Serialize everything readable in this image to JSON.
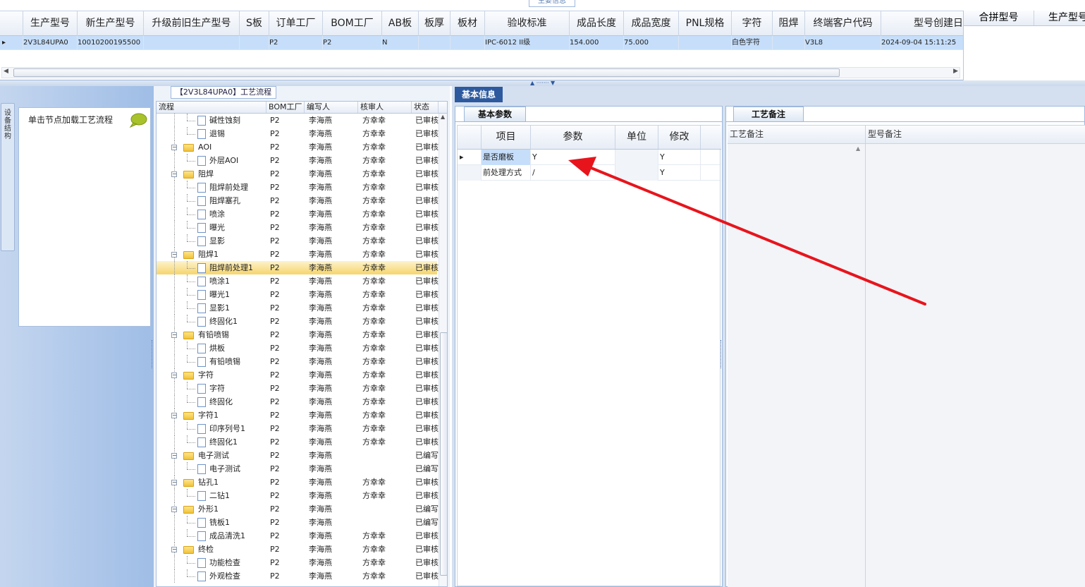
{
  "top_grid": {
    "caption": "主要信息",
    "columns": [
      "生产型号",
      "新生产型号",
      "升级前旧生产型号",
      "S板",
      "订单工厂",
      "BOM工厂",
      "AB板",
      "板厚",
      "板材",
      "验收标准",
      "成品长度",
      "成品宽度",
      "PNL规格",
      "字符",
      "阻焊",
      "终端客户代码",
      "型号创建日"
    ],
    "row": {
      "生产型号": "2V3L84UPA0",
      "新生产型号": "10010200195500",
      "升级前旧生产型号": "",
      "S板": "",
      "订单工厂": "P2",
      "BOM工厂": "P2",
      "AB板": "N",
      "板厚": "",
      "板材": "",
      "验收标准": "IPC-6012 II级",
      "成品长度": "154.000",
      "成品宽度": "75.000",
      "PNL规格": "",
      "字符": "白色字符",
      "阻焊": "",
      "终端客户代码": "V3L8",
      "型号创建日": "2024-09-04 15:11:25"
    }
  },
  "merge_panel": {
    "columns": [
      "合拼型号",
      "生产型号"
    ]
  },
  "left_sidebar": {
    "vertical_tab": "设备结构",
    "node_hint": "单击节点加载工艺流程"
  },
  "process_tree": {
    "caption": "【2V3L84UPA0】工艺流程",
    "columns": [
      "流程",
      "BOM工厂",
      "编写人",
      "核审人",
      "状态"
    ],
    "rows": [
      {
        "level": 2,
        "name": "碱性蚀刻",
        "bom": "P2",
        "writer": "李海燕",
        "reviewer": "方幸幸",
        "status": "已审核"
      },
      {
        "level": 2,
        "name": "退锡",
        "bom": "P2",
        "writer": "李海燕",
        "reviewer": "方幸幸",
        "status": "已审核"
      },
      {
        "level": 1,
        "name": "AOI",
        "bom": "P2",
        "writer": "李海燕",
        "reviewer": "方幸幸",
        "status": "已审核"
      },
      {
        "level": 2,
        "name": "外层AOI",
        "bom": "P2",
        "writer": "李海燕",
        "reviewer": "方幸幸",
        "status": "已审核"
      },
      {
        "level": 1,
        "name": "阻焊",
        "bom": "P2",
        "writer": "李海燕",
        "reviewer": "方幸幸",
        "status": "已审核"
      },
      {
        "level": 2,
        "name": "阻焊前处理",
        "bom": "P2",
        "writer": "李海燕",
        "reviewer": "方幸幸",
        "status": "已审核"
      },
      {
        "level": 2,
        "name": "阻焊塞孔",
        "bom": "P2",
        "writer": "李海燕",
        "reviewer": "方幸幸",
        "status": "已审核"
      },
      {
        "level": 2,
        "name": "喷涂",
        "bom": "P2",
        "writer": "李海燕",
        "reviewer": "方幸幸",
        "status": "已审核"
      },
      {
        "level": 2,
        "name": "曝光",
        "bom": "P2",
        "writer": "李海燕",
        "reviewer": "方幸幸",
        "status": "已审核"
      },
      {
        "level": 2,
        "name": "显影",
        "bom": "P2",
        "writer": "李海燕",
        "reviewer": "方幸幸",
        "status": "已审核"
      },
      {
        "level": 1,
        "name": "阻焊1",
        "bom": "P2",
        "writer": "李海燕",
        "reviewer": "方幸幸",
        "status": "已审核"
      },
      {
        "level": 2,
        "name": "阻焊前处理1",
        "bom": "P2",
        "writer": "李海燕",
        "reviewer": "方幸幸",
        "status": "已审核",
        "selected": true
      },
      {
        "level": 2,
        "name": "喷涂1",
        "bom": "P2",
        "writer": "李海燕",
        "reviewer": "方幸幸",
        "status": "已审核"
      },
      {
        "level": 2,
        "name": "曝光1",
        "bom": "P2",
        "writer": "李海燕",
        "reviewer": "方幸幸",
        "status": "已审核"
      },
      {
        "level": 2,
        "name": "显影1",
        "bom": "P2",
        "writer": "李海燕",
        "reviewer": "方幸幸",
        "status": "已审核"
      },
      {
        "level": 2,
        "name": "终固化1",
        "bom": "P2",
        "writer": "李海燕",
        "reviewer": "方幸幸",
        "status": "已审核"
      },
      {
        "level": 1,
        "name": "有铅喷锡",
        "bom": "P2",
        "writer": "李海燕",
        "reviewer": "方幸幸",
        "status": "已审核"
      },
      {
        "level": 2,
        "name": "烘板",
        "bom": "P2",
        "writer": "李海燕",
        "reviewer": "方幸幸",
        "status": "已审核"
      },
      {
        "level": 2,
        "name": "有铅喷锡",
        "bom": "P2",
        "writer": "李海燕",
        "reviewer": "方幸幸",
        "status": "已审核"
      },
      {
        "level": 1,
        "name": "字符",
        "bom": "P2",
        "writer": "李海燕",
        "reviewer": "方幸幸",
        "status": "已审核"
      },
      {
        "level": 2,
        "name": "字符",
        "bom": "P2",
        "writer": "李海燕",
        "reviewer": "方幸幸",
        "status": "已审核"
      },
      {
        "level": 2,
        "name": "终固化",
        "bom": "P2",
        "writer": "李海燕",
        "reviewer": "方幸幸",
        "status": "已审核"
      },
      {
        "level": 1,
        "name": "字符1",
        "bom": "P2",
        "writer": "李海燕",
        "reviewer": "方幸幸",
        "status": "已审核"
      },
      {
        "level": 2,
        "name": "印序列号1",
        "bom": "P2",
        "writer": "李海燕",
        "reviewer": "方幸幸",
        "status": "已审核"
      },
      {
        "level": 2,
        "name": "终固化1",
        "bom": "P2",
        "writer": "李海燕",
        "reviewer": "方幸幸",
        "status": "已审核"
      },
      {
        "level": 1,
        "name": "电子测试",
        "bom": "P2",
        "writer": "李海燕",
        "reviewer": "",
        "status": "已编写"
      },
      {
        "level": 2,
        "name": "电子测试",
        "bom": "P2",
        "writer": "李海燕",
        "reviewer": "",
        "status": "已编写"
      },
      {
        "level": 1,
        "name": "钻孔1",
        "bom": "P2",
        "writer": "李海燕",
        "reviewer": "方幸幸",
        "status": "已审核"
      },
      {
        "level": 2,
        "name": "二钻1",
        "bom": "P2",
        "writer": "李海燕",
        "reviewer": "方幸幸",
        "status": "已审核"
      },
      {
        "level": 1,
        "name": "外形1",
        "bom": "P2",
        "writer": "李海燕",
        "reviewer": "",
        "status": "已编写"
      },
      {
        "level": 2,
        "name": "铣板1",
        "bom": "P2",
        "writer": "李海燕",
        "reviewer": "",
        "status": "已编写"
      },
      {
        "level": 2,
        "name": "成品清洗1",
        "bom": "P2",
        "writer": "李海燕",
        "reviewer": "方幸幸",
        "status": "已审核"
      },
      {
        "level": 1,
        "name": "终检",
        "bom": "P2",
        "writer": "李海燕",
        "reviewer": "方幸幸",
        "status": "已审核"
      },
      {
        "level": 2,
        "name": "功能检查",
        "bom": "P2",
        "writer": "李海燕",
        "reviewer": "方幸幸",
        "status": "已审核"
      },
      {
        "level": 2,
        "name": "外观检查",
        "bom": "P2",
        "writer": "李海燕",
        "reviewer": "方幸幸",
        "status": "已审核"
      }
    ]
  },
  "basic_info": {
    "tab": "基本信息",
    "params_tab": "基本参数",
    "columns": [
      "项目",
      "参数",
      "单位",
      "修改"
    ],
    "rows": [
      {
        "item": "是否磨板",
        "param": "Y",
        "unit": "",
        "modify": "Y"
      },
      {
        "item": "前处理方式",
        "param": "/",
        "unit": "",
        "modify": "Y"
      }
    ]
  },
  "craft_notes": {
    "tab": "工艺备注",
    "columns": [
      "工艺备注",
      "型号备注"
    ]
  },
  "colors": {
    "selection": "#c6defa",
    "tree_selection": "#f6d56d",
    "tab_active": "#2d5a9e",
    "annotation_arrow": "#e8141c"
  }
}
